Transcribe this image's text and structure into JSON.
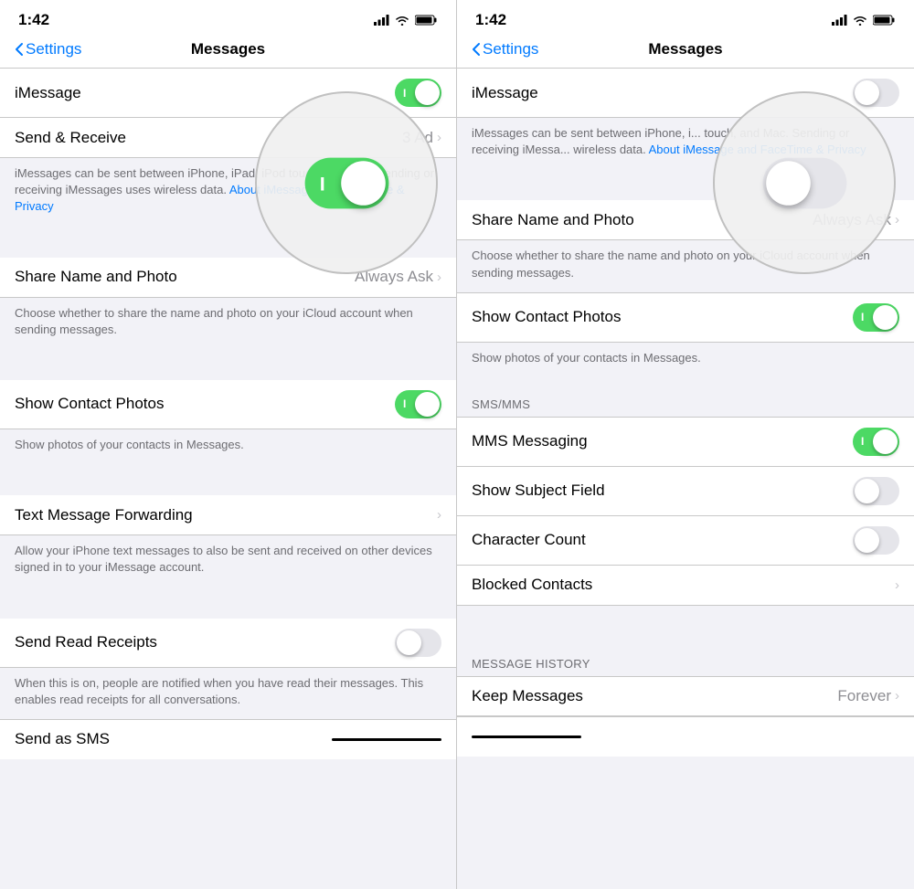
{
  "left_panel": {
    "status": {
      "time": "1:42"
    },
    "nav": {
      "back_label": "Settings",
      "title": "Messages"
    },
    "cells": [
      {
        "id": "imessage",
        "label": "iMessage",
        "control": "toggle",
        "state": "on"
      },
      {
        "id": "send-receive",
        "label": "Send & Receive",
        "value": "3 Ad",
        "control": "chevron"
      }
    ],
    "imessage_description": "iMessages can be sent between iPhone, iPad, iPod touch, and Mac. Sending or receiving iMessages uses wireless data.",
    "imessage_link": "About iMessage and FaceTime & Privacy",
    "share_name": {
      "label": "Share Name and Photo",
      "value": "Always Ask",
      "control": "chevron"
    },
    "share_name_description": "Choose whether to share the name and photo on your iCloud account when sending messages.",
    "show_contact_photos": {
      "label": "Show Contact Photos",
      "state": "on"
    },
    "show_contact_photos_description": "Show photos of your contacts in Messages.",
    "text_msg_forwarding": {
      "label": "Text Message Forwarding",
      "control": "chevron"
    },
    "text_msg_forwarding_description": "Allow your iPhone text messages to also be sent and received on other devices signed in to your iMessage account.",
    "send_read_receipts": {
      "label": "Send Read Receipts",
      "state": "off"
    },
    "send_read_receipts_description": "When this is on, people are notified when you have read their messages. This enables read receipts for all conversations.",
    "send_as_sms": {
      "label": "Send as SMS"
    }
  },
  "right_panel": {
    "status": {
      "time": "1:42"
    },
    "nav": {
      "back_label": "Settings",
      "title": "Messages"
    },
    "imessage": {
      "label": "iMessage",
      "state": "off"
    },
    "imessage_description": "iMessages can be sent between iPhone, i... touch, and Mac. Sending or receiving iMessa... wireless data.",
    "imessage_link": "About iMessage and FaceTime & Privacy",
    "share_name": {
      "label": "Share Name and Photo",
      "value": "Always Ask"
    },
    "share_name_description": "Choose whether to share the name and photo on your iCloud account when sending messages.",
    "show_contact_photos": {
      "label": "Show Contact Photos",
      "state": "on"
    },
    "show_contact_photos_description": "Show photos of your contacts in Messages.",
    "smsmms_header": "SMS/MMS",
    "mms_messaging": {
      "label": "MMS Messaging",
      "state": "on"
    },
    "show_subject_field": {
      "label": "Show Subject Field",
      "state": "off"
    },
    "character_count": {
      "label": "Character Count",
      "state": "off"
    },
    "blocked_contacts": {
      "label": "Blocked Contacts",
      "control": "chevron"
    },
    "msg_history_header": "MESSAGE HISTORY",
    "keep_messages": {
      "label": "Keep Messages",
      "value": "Forever"
    }
  }
}
